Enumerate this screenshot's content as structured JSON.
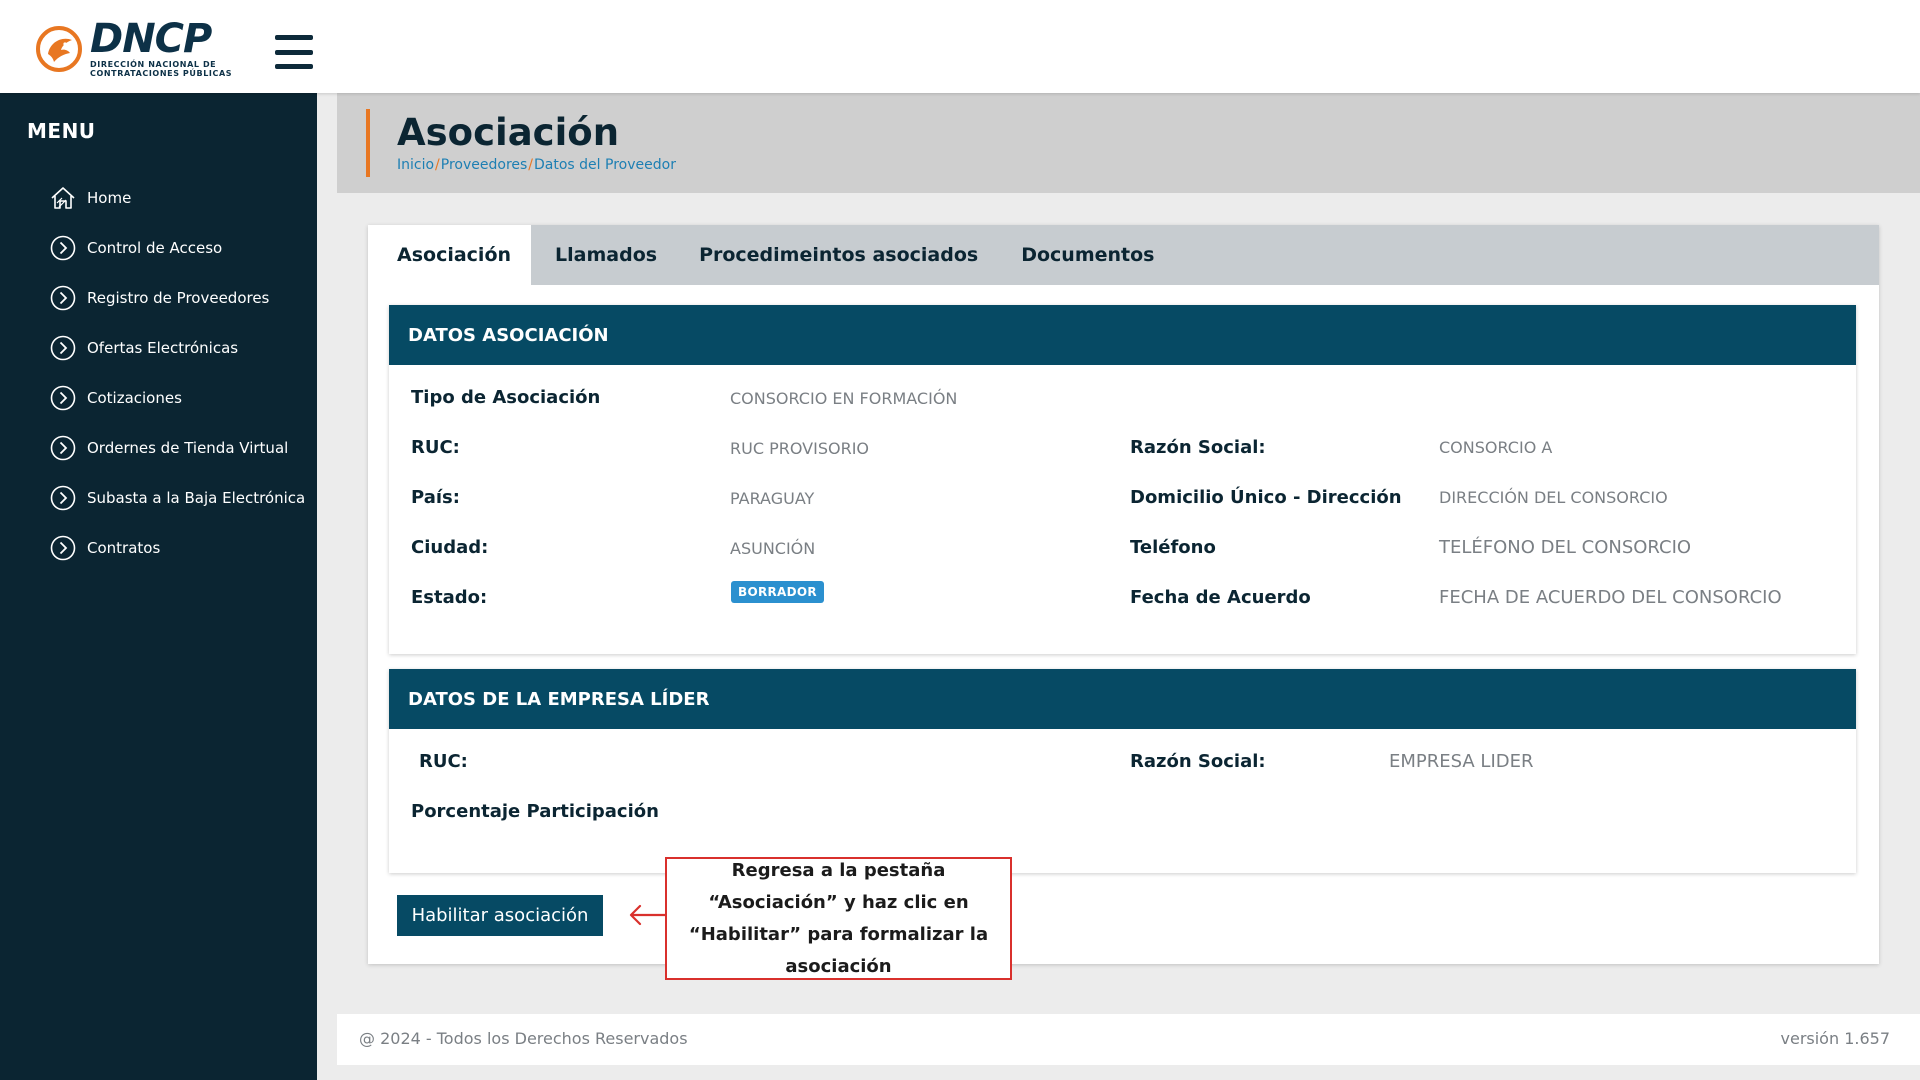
{
  "brand": {
    "name": "DNCP",
    "sub_line1": "DIRECCIÓN NACIONAL DE",
    "sub_line2": "CONTRATACIONES PÚBLICAS",
    "accent_color": "#e87722",
    "primary_color": "#064a64"
  },
  "sidebar": {
    "title": "MENU",
    "items": [
      {
        "label": "Home",
        "icon": "home-icon"
      },
      {
        "label": "Control de Acceso",
        "icon": "chevron-right-circle-icon"
      },
      {
        "label": "Registro de Proveedores",
        "icon": "chevron-right-circle-icon"
      },
      {
        "label": "Ofertas Electrónicas",
        "icon": "chevron-right-circle-icon"
      },
      {
        "label": "Cotizaciones",
        "icon": "chevron-right-circle-icon"
      },
      {
        "label": "Ordernes de Tienda Virtual",
        "icon": "chevron-right-circle-icon"
      },
      {
        "label": "Subasta a la Baja Electrónica",
        "icon": "chevron-right-circle-icon"
      },
      {
        "label": "Contratos",
        "icon": "chevron-right-circle-icon"
      }
    ]
  },
  "page": {
    "title": "Asociación",
    "breadcrumb": [
      "Inicio",
      "Proveedores",
      "Datos del Proveedor"
    ]
  },
  "tabs": [
    {
      "label": "Asociación",
      "active": true
    },
    {
      "label": "Llamados",
      "active": false
    },
    {
      "label": "Procedimeintos asociados",
      "active": false
    },
    {
      "label": "Documentos",
      "active": false
    }
  ],
  "asociacion": {
    "header": "DATOS ASOCIACIÓN",
    "tipo_label": "Tipo de Asociación",
    "tipo_value": "CONSORCIO EN FORMACIÓN",
    "ruc_label": "RUC:",
    "ruc_value": "RUC PROVISORIO",
    "razon_label": "Razón Social:",
    "razon_value": "CONSORCIO A",
    "pais_label": "País:",
    "pais_value": "PARAGUAY",
    "domicilio_label": "Domicilio Único - Dirección",
    "domicilio_value": "DIRECCIÓN DEL CONSORCIO",
    "ciudad_label": "Ciudad:",
    "ciudad_value": "ASUNCIÓN",
    "telefono_label": "Teléfono",
    "telefono_value": "TELÉFONO DEL CONSORCIO",
    "estado_label": "Estado:",
    "estado_value": "BORRADOR",
    "fecha_label": "Fecha de Acuerdo",
    "fecha_value": "FECHA DE ACUERDO DEL CONSORCIO"
  },
  "empresa_lider": {
    "header": "DATOS DE LA EMPRESA LÍDER",
    "ruc_label": "RUC:",
    "razon_label": "Razón Social:",
    "razon_value": "EMPRESA LIDER",
    "porcentaje_label": "Porcentaje Participación"
  },
  "actions": {
    "habilitar_label": "Habilitar asociación"
  },
  "callout": {
    "text": "Regresa a la pestaña “Asociación” y haz clic en “Habilitar” para formalizar la asociación"
  },
  "footer": {
    "copyright": "@ 2024 - Todos los Derechos Reservados",
    "version": "versión 1.657"
  }
}
